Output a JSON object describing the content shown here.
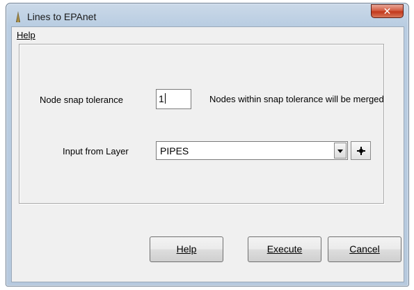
{
  "window": {
    "title": "Lines to EPAnet",
    "close_glyph": "✕"
  },
  "menu": {
    "help_label": "Help"
  },
  "form": {
    "tolerance_label": "Node snap tolerance",
    "tolerance_value": "1",
    "tolerance_hint": "Nodes within snap tolerance will be merged",
    "layer_label": "Input from Layer",
    "layer_value": "PIPES",
    "add_layer_icon": "plus-icon",
    "dropdown_icon": "chevron-down-icon"
  },
  "buttons": {
    "help": "Help",
    "execute": "Execute",
    "cancel": "Cancel"
  },
  "colors": {
    "titlebar": "#b9cde2",
    "client": "#f0f0f0",
    "close": "#c2381b"
  }
}
